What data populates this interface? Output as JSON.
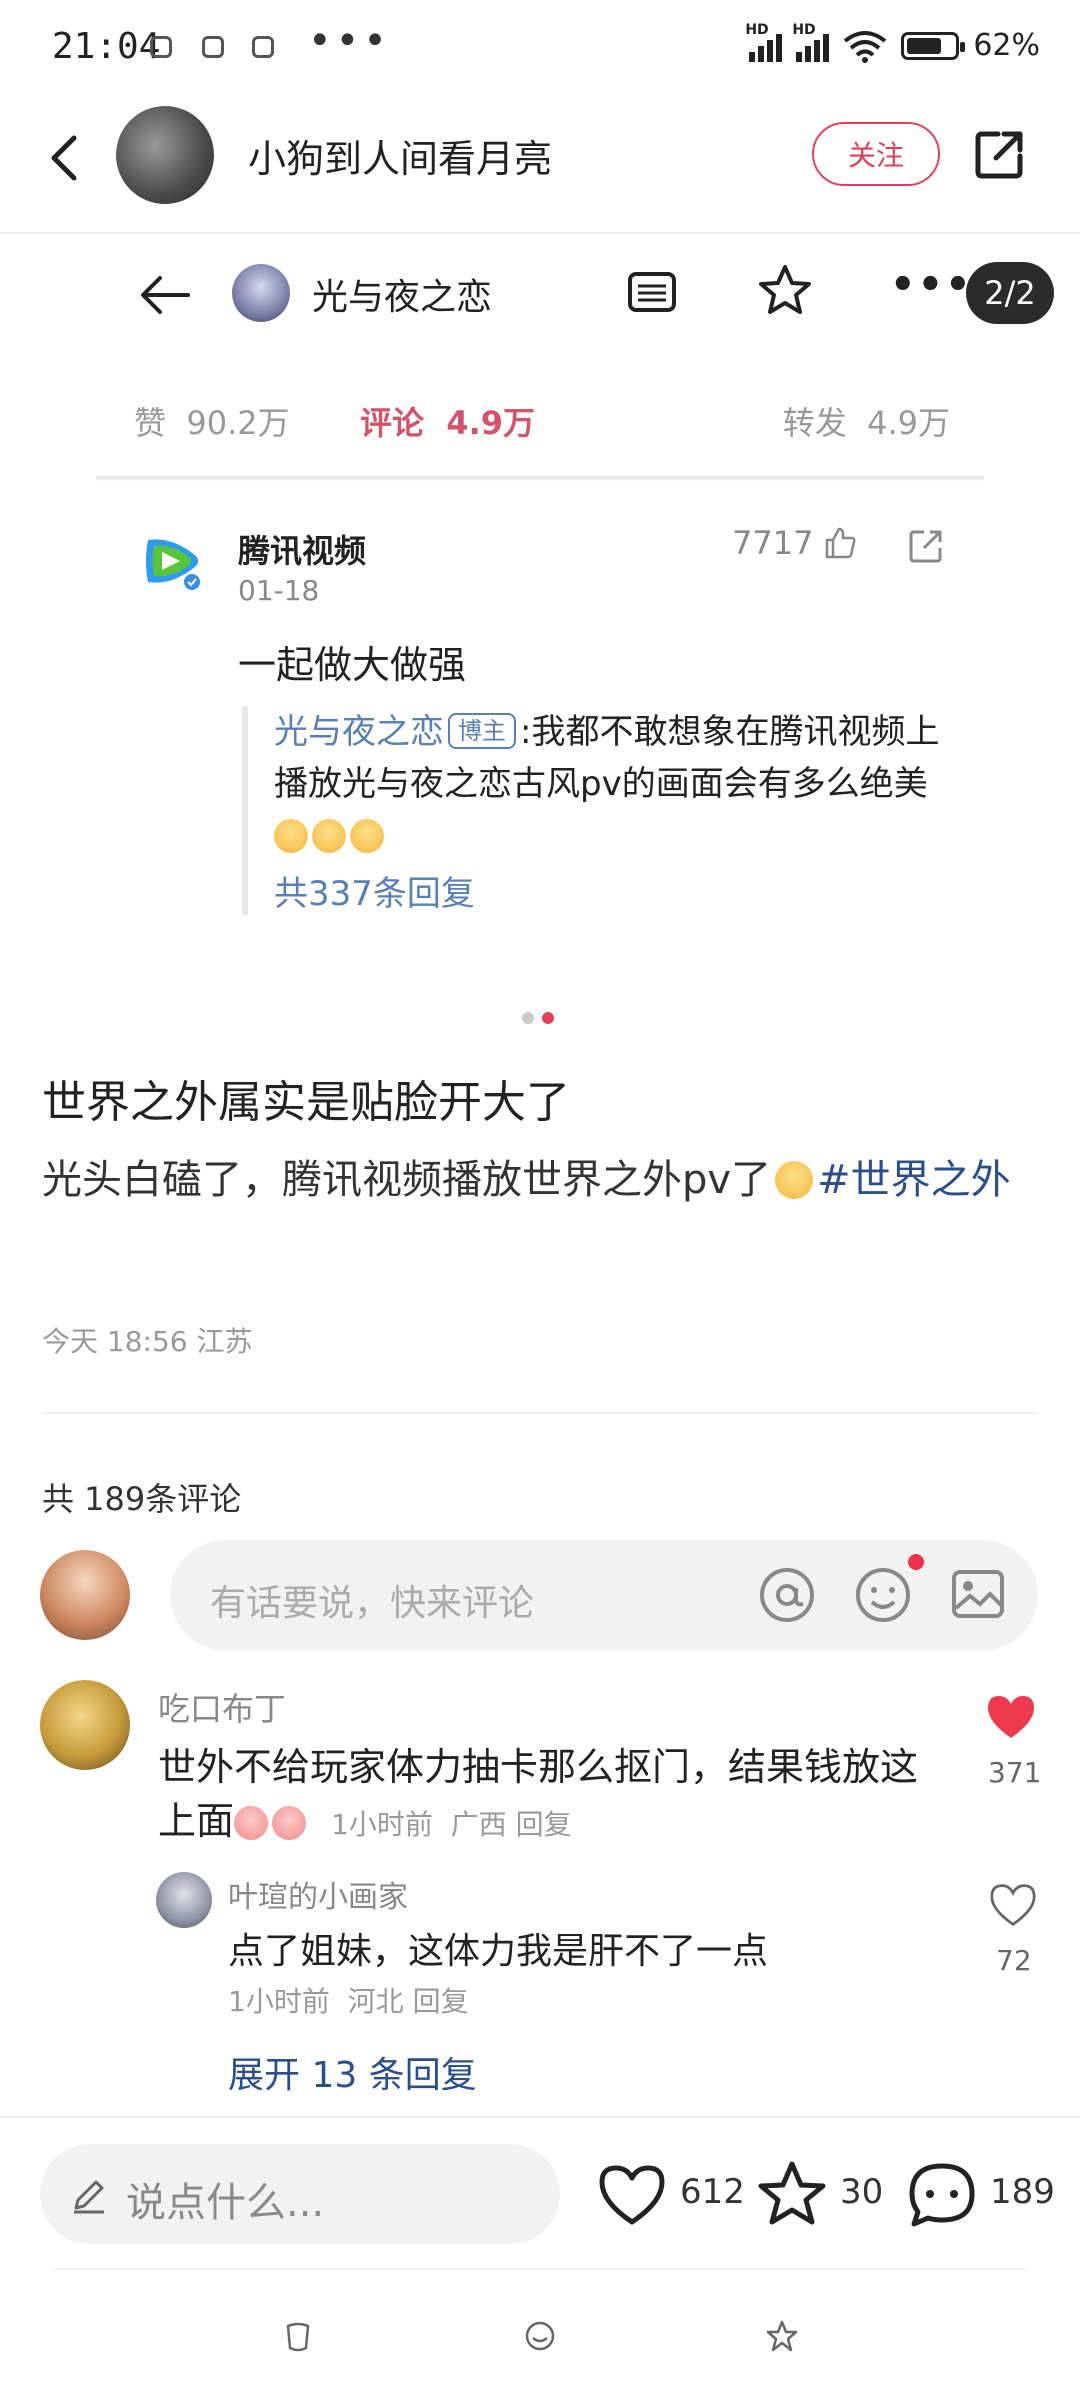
{
  "status_bar": {
    "time": "21:04",
    "dots": "•••",
    "battery": "62%"
  },
  "header": {
    "username": "小狗到人间看月亮",
    "follow_label": "关注"
  },
  "embedded": {
    "title": "光与夜之恋",
    "page": "2/2",
    "more": "•••",
    "stats": {
      "like_label": "赞",
      "like_value": "90.2万",
      "comment_label": "评论",
      "comment_value": "4.9万",
      "repost_label": "转发",
      "repost_value": "4.9万"
    },
    "comment": {
      "author": "腾讯视频",
      "date": "01-18",
      "likes": "7717",
      "text": "一起做大做强",
      "quote": {
        "author": "光与夜之恋",
        "tag": "博主",
        "separator": ":",
        "text": "我都不敢想象在腾讯视频上播放光与夜之恋古风pv的画面会有多么绝美",
        "replies": "共337条回复"
      }
    }
  },
  "post": {
    "title": "世界之外属实是贴脸开大了",
    "body": "光头白磕了，腾讯视频播放世界之外pv了",
    "hashtag": "#世界之外",
    "time": "今天 18:56",
    "location": "江苏"
  },
  "comments_section": {
    "count_label": "共 189条评论",
    "input_placeholder": "有话要说，快来评论",
    "items": [
      {
        "author": "吃口布丁",
        "text": "世外不给玩家体力抽卡那么抠门，结果钱放这上面",
        "time": "1小时前",
        "location": "广西",
        "reply_label": "回复",
        "likes": "371",
        "liked": true
      }
    ],
    "reply": {
      "author": "叶瑄的小画家",
      "text": "点了姐妹，这体力我是肝不了一点",
      "time": "1小时前",
      "location": "河北",
      "reply_label": "回复",
      "likes": "72"
    },
    "expand_label": "展开 13 条回复"
  },
  "bottom_bar": {
    "placeholder": "说点什么...",
    "likes": "612",
    "stars": "30",
    "comments": "189"
  },
  "colors": {
    "accent": "#e0405a",
    "link": "#2b4f8a",
    "quote_link": "#5a7fb5"
  },
  "icons": [
    "back-icon",
    "share-icon",
    "list-icon",
    "star-icon",
    "thumb-icon",
    "at-icon",
    "emoji-icon",
    "image-icon",
    "heart-icon",
    "pen-icon",
    "comment-icon"
  ]
}
